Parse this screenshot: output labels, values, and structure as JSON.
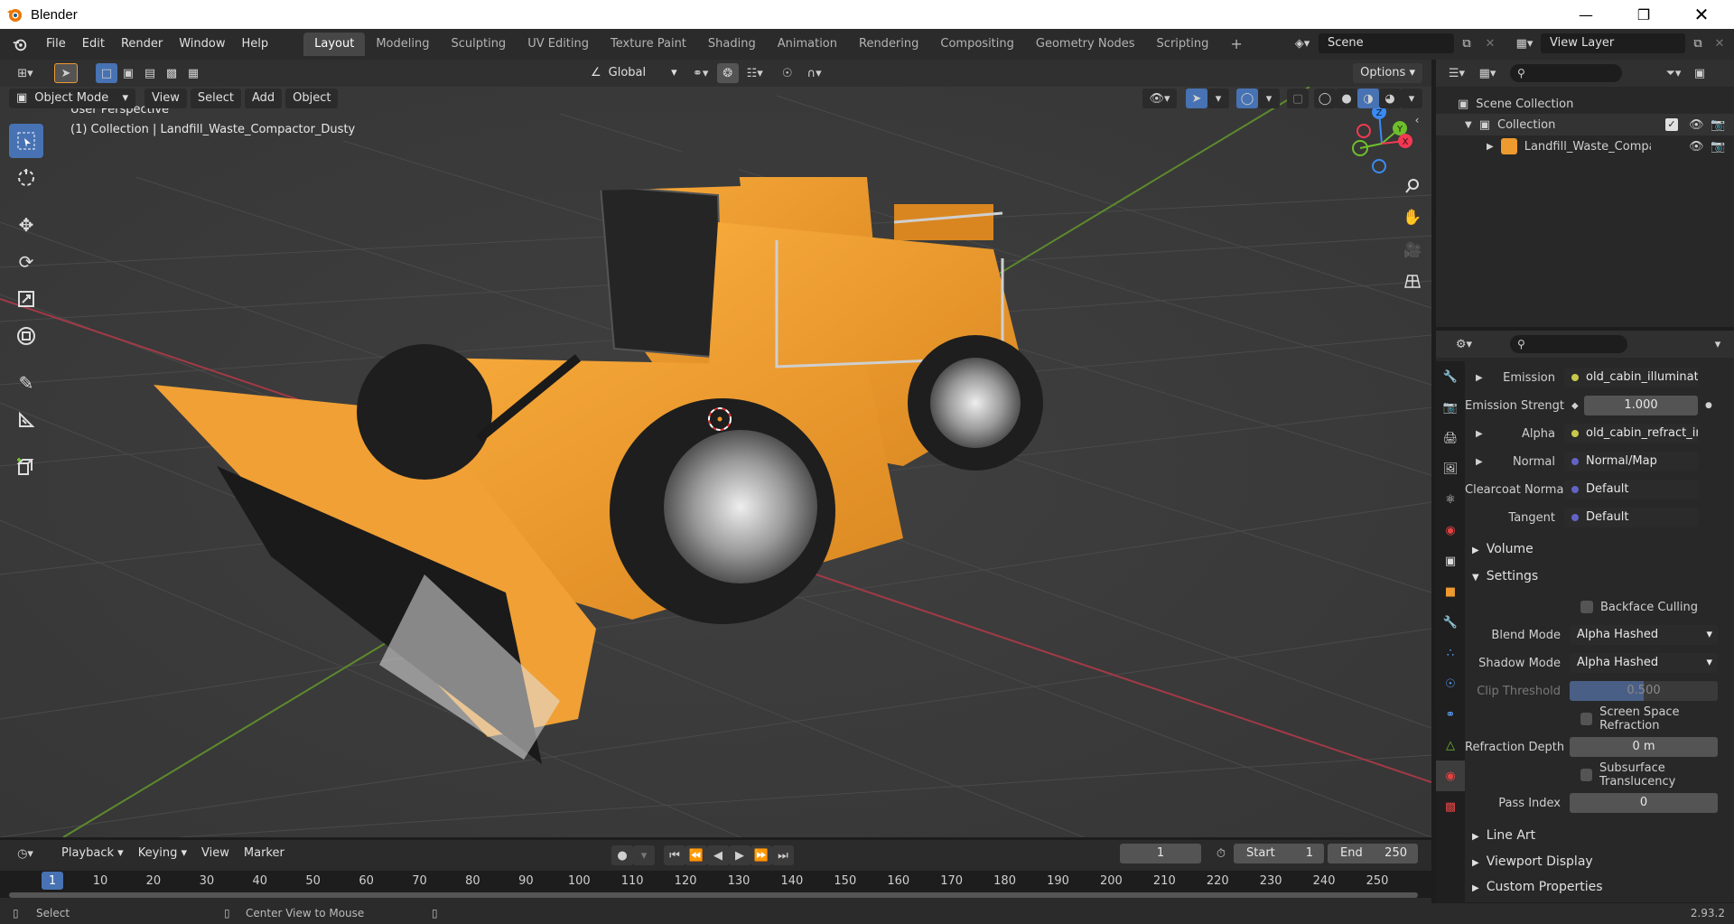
{
  "window": {
    "title": "Blender"
  },
  "menu": [
    "File",
    "Edit",
    "Render",
    "Window",
    "Help"
  ],
  "workspaces": [
    "Layout",
    "Modeling",
    "Sculpting",
    "UV Editing",
    "Texture Paint",
    "Shading",
    "Animation",
    "Rendering",
    "Compositing",
    "Geometry Nodes",
    "Scripting"
  ],
  "scene": {
    "name": "Scene",
    "view_layer": "View Layer"
  },
  "viewport": {
    "mode": "Object Mode",
    "menus": [
      "View",
      "Select",
      "Add",
      "Object"
    ],
    "orientation": "Global",
    "options_label": "Options",
    "perspective_label": "User Perspective",
    "collection_label": "(1) Collection | Landfill_Waste_Compactor_Dusty",
    "gizmo": {
      "x": "X",
      "y": "Y",
      "z": "Z"
    }
  },
  "outliner": {
    "scene_collection": "Scene Collection",
    "collection": "Collection",
    "object": "Landfill_Waste_Compact"
  },
  "properties": {
    "rows": [
      {
        "label": "Emission",
        "value": "old_cabin_illuminati...",
        "dot": "#c8c84a",
        "expand": true
      },
      {
        "label": "Emission Strengt",
        "value": "1.000",
        "dot": "",
        "expand": false,
        "numeric": true
      },
      {
        "label": "Alpha",
        "value": "old_cabin_refract_in...",
        "dot": "#c8c84a",
        "expand": true
      },
      {
        "label": "Normal",
        "value": "Normal/Map",
        "dot": "#6363c7",
        "expand": true
      },
      {
        "label": "Clearcoat Normal",
        "value": "Default",
        "dot": "#6363c7",
        "expand": false
      },
      {
        "label": "Tangent",
        "value": "Default",
        "dot": "#6363c7",
        "expand": false
      }
    ],
    "volume": "Volume",
    "settings": "Settings",
    "backface_culling": "Backface Culling",
    "blend_mode_label": "Blend Mode",
    "blend_mode": "Alpha Hashed",
    "shadow_mode_label": "Shadow Mode",
    "shadow_mode": "Alpha Hashed",
    "clip_threshold_label": "Clip Threshold",
    "clip_threshold": "0.500",
    "screen_space_refraction": "Screen Space Refraction",
    "refraction_depth_label": "Refraction Depth",
    "refraction_depth": "0 m",
    "subsurface_translucency": "Subsurface Translucency",
    "pass_index_label": "Pass Index",
    "pass_index": "0",
    "line_art": "Line Art",
    "viewport_display": "Viewport Display",
    "custom_properties": "Custom Properties"
  },
  "timeline": {
    "menus": [
      "Playback",
      "Keying",
      "View",
      "Marker"
    ],
    "current_frame": "1",
    "start_label": "Start",
    "start": "1",
    "end_label": "End",
    "end": "250",
    "ticks": [
      "1",
      "10",
      "20",
      "30",
      "40",
      "50",
      "60",
      "70",
      "80",
      "90",
      "100",
      "110",
      "120",
      "130",
      "140",
      "150",
      "160",
      "170",
      "180",
      "190",
      "200",
      "210",
      "220",
      "230",
      "240",
      "250"
    ]
  },
  "status": {
    "select": "Select",
    "center_view": "Center View to Mouse",
    "version": "2.93.2"
  },
  "colors": {
    "accent": "#4772b3",
    "orange": "#ed9a2e",
    "x_axis": "#f13a52",
    "y_axis": "#6ebf2b",
    "z_axis": "#3a8bf1"
  }
}
